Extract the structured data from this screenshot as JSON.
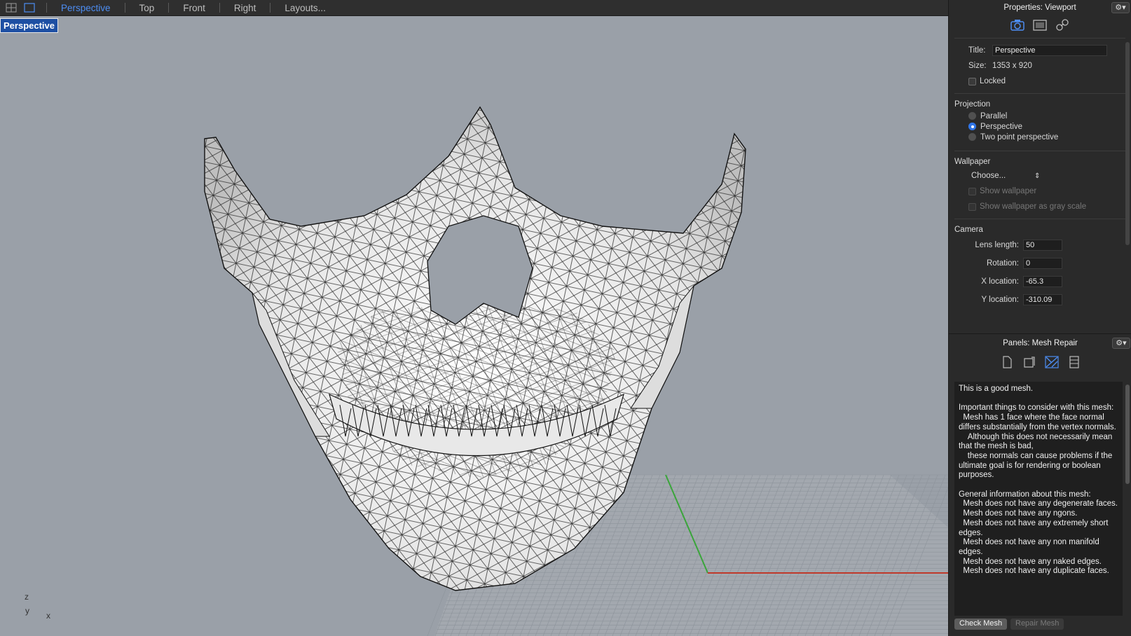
{
  "tabs": {
    "items": [
      "Perspective",
      "Top",
      "Front",
      "Right",
      "Layouts..."
    ],
    "active": "Perspective"
  },
  "viewport": {
    "label": "Perspective",
    "axis_z": "z",
    "axis_y": "y",
    "axis_x": "x"
  },
  "properties": {
    "title": "Properties: Viewport",
    "title_label": "Title:",
    "title_value": "Perspective",
    "size_label": "Size:",
    "size_value": "1353 x 920",
    "locked_label": "Locked",
    "projection_head": "Projection",
    "projection_options": [
      "Parallel",
      "Perspective",
      "Two point perspective"
    ],
    "projection_selected": "Perspective",
    "wallpaper_head": "Wallpaper",
    "wallpaper_choose": "Choose...",
    "show_wallpaper": "Show wallpaper",
    "show_wallpaper_gray": "Show wallpaper as gray scale",
    "camera_head": "Camera",
    "lens_label": "Lens length:",
    "lens_value": "50",
    "rotation_label": "Rotation:",
    "rotation_value": "0",
    "xloc_label": "X location:",
    "xloc_value": "-65.3",
    "yloc_label": "Y location:",
    "yloc_value": "-310.09"
  },
  "mesh_repair": {
    "title": "Panels: Mesh Repair",
    "report": "This is a good mesh.\n\nImportant things to consider with this mesh:\n  Mesh has 1 face where the face normal differs substantially from the vertex normals.\n    Although this does not necessarily mean that the mesh is bad,\n    these normals can cause problems if the ultimate goal is for rendering or boolean purposes.\n\nGeneral information about this mesh:\n  Mesh does not have any degenerate faces.\n  Mesh does not have any ngons.\n  Mesh does not have any extremely short edges.\n  Mesh does not have any non manifold edges.\n  Mesh does not have any naked edges.\n  Mesh does not have any duplicate faces.",
    "check_label": "Check Mesh",
    "repair_label": "Repair Mesh"
  },
  "colors": {
    "accent": "#4d8df2",
    "viewport_bg": "#9aa0a8",
    "x_axis": "#c0392b",
    "y_axis": "#3aa53a"
  },
  "icons": [
    "grid-icon",
    "viewport-icon",
    "camera-icon",
    "display-icon",
    "linked-icon",
    "gear-icon",
    "document-icon",
    "notes-icon",
    "mesh-repair-icon",
    "table-icon"
  ]
}
